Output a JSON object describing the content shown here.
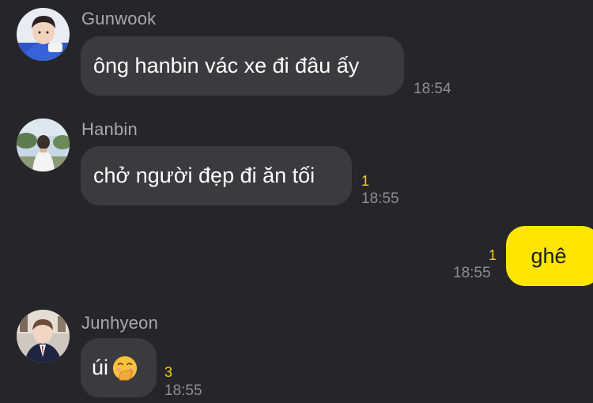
{
  "messages": [
    {
      "sender": "Gunwook",
      "text": "ông hanbin vác xe đi đâu ấy",
      "time": "18:54",
      "unread": ""
    },
    {
      "sender": "Hanbin",
      "text": "chở người đẹp đi ăn tối",
      "time": "18:55",
      "unread": "1"
    },
    {
      "sender": "",
      "text": "ghê",
      "time": "18:55",
      "unread": "1"
    },
    {
      "sender": "Junhyeon",
      "text": "úi",
      "time": "18:55",
      "unread": "3",
      "emoji": "face-with-hand-over-mouth-icon"
    }
  ],
  "colors": {
    "background": "#26262a",
    "incoming_bubble": "#3b3b3f",
    "outgoing_bubble": "#fee500",
    "unread_count": "#f5d300",
    "timestamp": "#8e8e92"
  }
}
